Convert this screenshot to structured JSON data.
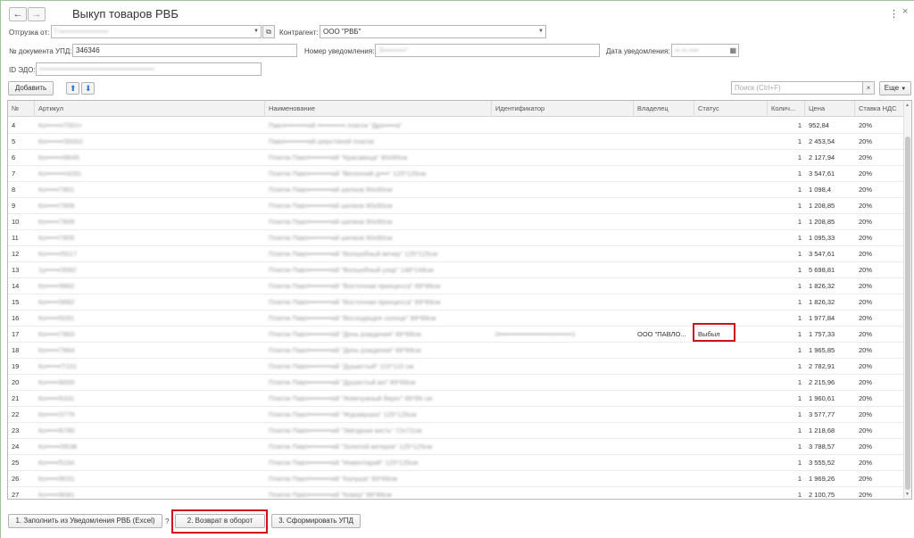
{
  "window": {
    "title": "Выкуп товаров РВБ",
    "back_glyph": "←",
    "forward_glyph": "→",
    "more_glyph": "⋮",
    "close_glyph": "×"
  },
  "form": {
    "shipment_label": "Отгрузка от:",
    "shipment_value": "Г••••••••••••••••••••",
    "counterparty_label": "Контрагент:",
    "counterparty_value": "ООО \"РВБ\"",
    "upd_label": "№ документа УПД:",
    "upd_value": "346346",
    "notice_no_label": "Номер уведомления:",
    "notice_no_value": "З•••••••••*",
    "notice_date_label": "Дата уведомления:",
    "notice_date_value": "••.••.••••",
    "edo_label": "ID ЭДО:",
    "edo_value": "••••••••••••••••••••••••••••••••••••••••••••••"
  },
  "toolbar": {
    "add_label": "Добавить",
    "search_placeholder": "Поиск (Ctrl+F)",
    "more_label": "Еще",
    "up_glyph": "⬆",
    "down_glyph": "⬇",
    "clear_glyph": "×"
  },
  "table": {
    "headers": [
      "№",
      "Артикул",
      "Наименование",
      "Идентификатор",
      "Владелец",
      "Статус",
      "Колич...",
      "Цена",
      "Ставка НДС"
    ],
    "rows": [
      {
        "n": "4",
        "art": "Ко•••••••/7001•",
        "name": "Павл••••••••••ий •••••••••••• платок \"Дро•••••а\"",
        "id": "",
        "owner": "",
        "status": "",
        "qty": "1",
        "price": "952,84",
        "vat": "20%"
      },
      {
        "n": "5",
        "art": "Ко•••••••/30002",
        "name": "Павл••••••••••ий шерстяной платок",
        "id": "",
        "owner": "",
        "status": "",
        "qty": "1",
        "price": "2 453,54",
        "vat": "20%"
      },
      {
        "n": "6",
        "art": "Ко•••••••/8645",
        "name": "Платок Павл••••••••••ий \"Красавица\" 90х90см",
        "id": "",
        "owner": "",
        "status": "",
        "qty": "1",
        "price": "2 127,94",
        "vat": "20%"
      },
      {
        "n": "7",
        "art": "Ко••••••••/4281",
        "name": "Платок Павл••••••••••ий \"Весенний д••••\" 125*125см",
        "id": "",
        "owner": "",
        "status": "",
        "qty": "1",
        "price": "3 547,61",
        "vat": "20%"
      },
      {
        "n": "8",
        "art": "Ко•••••/7801",
        "name": "Платок Павл••••••••••ий шелков 90х90см",
        "id": "",
        "owner": "",
        "status": "",
        "qty": "1",
        "price": "1 098,4",
        "vat": "20%"
      },
      {
        "n": "9",
        "art": "Ко•••••/7809",
        "name": "Платок Павл••••••••••ий шелков 90х90см",
        "id": "",
        "owner": "",
        "status": "",
        "qty": "1",
        "price": "1 208,85",
        "vat": "20%"
      },
      {
        "n": "10",
        "art": "Ко•••••/7809",
        "name": "Платок Павл••••••••••ий шелков 90х90см",
        "id": "",
        "owner": "",
        "status": "",
        "qty": "1",
        "price": "1 208,85",
        "vat": "20%"
      },
      {
        "n": "11",
        "art": "Ко•••••/7805",
        "name": "Платок Павл••••••••••ий шелков 90х90см",
        "id": "",
        "owner": "",
        "status": "",
        "qty": "1",
        "price": "1 095,33",
        "vat": "20%"
      },
      {
        "n": "12",
        "art": "Ко••••••/5017",
        "name": "Платок Павл••••••••••ий \"Волшебный вечер\" 125*125см",
        "id": "",
        "owner": "",
        "status": "",
        "qty": "1",
        "price": "3 547,61",
        "vat": "20%"
      },
      {
        "n": "13",
        "art": "1у••••••/3582",
        "name": "Платок Павл••••••••••ий \"Волшебный узор\" 148*148см",
        "id": "",
        "owner": "",
        "status": "",
        "qty": "1",
        "price": "5 698,81",
        "vat": "20%"
      },
      {
        "n": "14",
        "art": "Ко•••••/9882",
        "name": "Платок Павл••••••••••ий \"Восточная принцесса\" 89*89см",
        "id": "",
        "owner": "",
        "status": "",
        "qty": "1",
        "price": "1 826,32",
        "vat": "20%"
      },
      {
        "n": "15",
        "art": "Ко•••••/9882",
        "name": "Платок Павл••••••••••ий \"Восточная принцесса\" 89*89см",
        "id": "",
        "owner": "",
        "status": "",
        "qty": "1",
        "price": "1 826,32",
        "vat": "20%"
      },
      {
        "n": "16",
        "art": "Ко•••••/9281",
        "name": "Платок Павл••••••••••ий \"Восходящее солнце\" 89*89см",
        "id": "",
        "owner": "",
        "status": "",
        "qty": "1",
        "price": "1 977,84",
        "vat": "20%"
      },
      {
        "n": "17",
        "art": "Ко•••••/7863",
        "name": "Платок Павл••••••••••ий \"День рождения\" 89*89см",
        "id": "0•••••••••••••••••••••••••••••••1",
        "owner": "ООО \"ПАВЛО...",
        "status": "Выбыл",
        "qty": "1",
        "price": "1 757,33",
        "vat": "20%"
      },
      {
        "n": "18",
        "art": "Ко•••••/7864",
        "name": "Платок Павл••••••••••ий \"День рождения\" 89*89см",
        "id": "",
        "owner": "",
        "status": "",
        "qty": "1",
        "price": "1 965,85",
        "vat": "20%"
      },
      {
        "n": "19",
        "art": "Ко••••••/7101",
        "name": "Платок Павл••••••••••ий \"Душистый\" 110*110 см",
        "id": "",
        "owner": "",
        "status": "",
        "qty": "1",
        "price": "2 782,91",
        "vat": "20%"
      },
      {
        "n": "20",
        "art": "Ко•••••/8009",
        "name": "Платок Павл••••••••••ий \"Душистый мо\" 89*89см",
        "id": "",
        "owner": "",
        "status": "",
        "qty": "1",
        "price": "2 215,96",
        "vat": "20%"
      },
      {
        "n": "21",
        "art": "Ко•••••/6331",
        "name": "Платок Павл••••••••••ий \"Жемчужный берег\" 89*89 см",
        "id": "",
        "owner": "",
        "status": "",
        "qty": "1",
        "price": "1 960,61",
        "vat": "20%"
      },
      {
        "n": "22",
        "art": "Ко•••••/3779",
        "name": "Платок Павл••••••••••ий \"Журавушка\" 125*125см",
        "id": "",
        "owner": "",
        "status": "",
        "qty": "1",
        "price": "3 577,77",
        "vat": "20%"
      },
      {
        "n": "23",
        "art": "Ко•••••/6780",
        "name": "Платок Павл••••••••••ий \"Звёздная кисть\" 72х72см",
        "id": "",
        "owner": "",
        "status": "",
        "qty": "1",
        "price": "1 218,68",
        "vat": "20%"
      },
      {
        "n": "24",
        "art": "Ко••••••/9538",
        "name": "Платок Павл••••••••••ий \"Золотой ветерок\" 125*125см",
        "id": "",
        "owner": "",
        "status": "",
        "qty": "1",
        "price": "3 788,57",
        "vat": "20%"
      },
      {
        "n": "25",
        "art": "Ко•••••/5164",
        "name": "Платок Павл••••••••••ий \"Инвентарий\" 125*125см",
        "id": "",
        "owner": "",
        "status": "",
        "qty": "1",
        "price": "3 555,52",
        "vat": "20%"
      },
      {
        "n": "26",
        "art": "Ко•••••/8031",
        "name": "Платок Павл••••••••••ий \"Калуша\" 89*89см",
        "id": "",
        "owner": "",
        "status": "",
        "qty": "1",
        "price": "1 969,26",
        "vat": "20%"
      },
      {
        "n": "27",
        "art": "Ко•••••/8081",
        "name": "Платок Павл••••••••••ий \"Ковер\" 89*89см",
        "id": "",
        "owner": "",
        "status": "",
        "qty": "1",
        "price": "2 100,75",
        "vat": "20%"
      }
    ]
  },
  "footer": {
    "fill_label": "1. Заполнить из Уведомления РВБ (Excel)",
    "help_glyph": "?",
    "return_label": "2. Возврат в оборот",
    "upd_label": "3. Сформировать УПД"
  }
}
